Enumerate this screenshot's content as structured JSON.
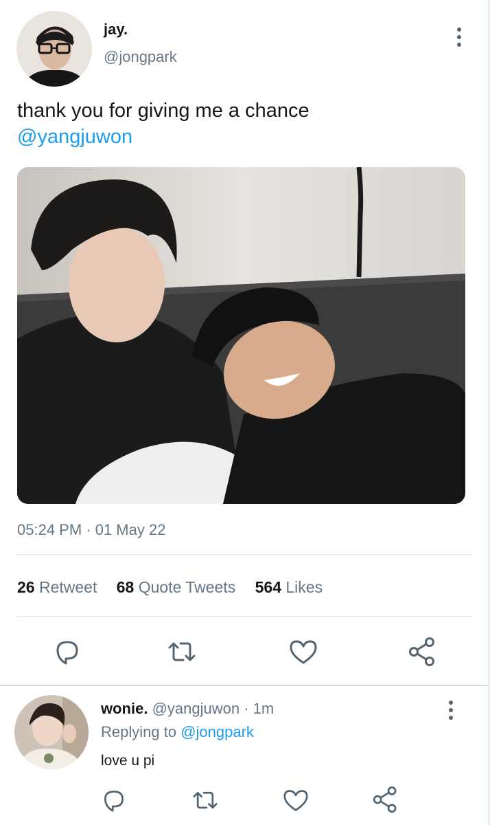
{
  "tweet": {
    "author_name": "jay.",
    "author_handle": "@jongpark",
    "text": "thank you for giving me a chance",
    "mention": "@yangjuwon",
    "timestamp": "05:24 PM · 01 May 22",
    "stats": {
      "retweets_count": "26",
      "retweets_label": "Retweet",
      "quotes_count": "68",
      "quotes_label": "Quote Tweets",
      "likes_count": "564",
      "likes_label": "Likes"
    }
  },
  "reply": {
    "author_name": "wonie.",
    "author_handle": "@yangjuwon",
    "time": "· 1m",
    "replying_label": "Replying to",
    "replying_handle": "@jongpark",
    "text": "love u pi"
  },
  "icons": {
    "reply": "speech-bubble-icon",
    "retweet": "retweet-icon",
    "like": "heart-icon",
    "share": "share-icon",
    "more": "more-vertical-icon"
  },
  "colors": {
    "accent": "#1d9bf0",
    "muted": "#657786",
    "icon": "#536471"
  }
}
